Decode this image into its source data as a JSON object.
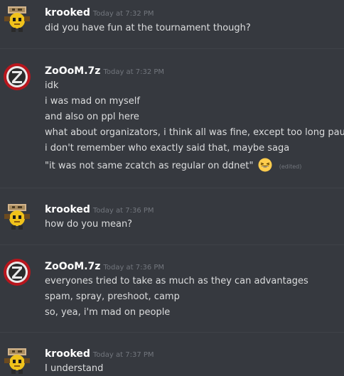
{
  "messages": [
    {
      "username": "krooked",
      "timestamp": "Today at 7:32 PM",
      "avatar_icon": "pixel-hero-avatar-icon",
      "lines": [
        "did you have fun at the tournament though?"
      ]
    },
    {
      "username": "ZoOoM.7z",
      "timestamp": "Today at 7:32 PM",
      "avatar_icon": "z-logo-avatar-icon",
      "lines": [
        "idk",
        "i was mad on myself",
        "and also on ppl here",
        "what about organizators, i think all was fine, except too long pauses",
        "i don't remember who exactly said that, maybe saga",
        "\"it was not same zcatch as regular on ddnet\""
      ],
      "edited_label": "(edited)",
      "emoji_icon": "grinning-squint-emoji-icon"
    },
    {
      "username": "krooked",
      "timestamp": "Today at 7:36 PM",
      "avatar_icon": "pixel-hero-avatar-icon",
      "lines": [
        "how do you mean?"
      ]
    },
    {
      "username": "ZoOoM.7z",
      "timestamp": "Today at 7:36 PM",
      "avatar_icon": "z-logo-avatar-icon",
      "lines": [
        "everyones tried to take as much as they can advantages",
        "spam, spray, preshoot, camp",
        "so, yea, i'm mad on people"
      ]
    },
    {
      "username": "krooked",
      "timestamp": "Today at 7:37 PM",
      "avatar_icon": "pixel-hero-avatar-icon",
      "lines": [
        "I understand"
      ]
    }
  ],
  "colors": {
    "background": "#36393f",
    "username": "#ffffff",
    "timestamp": "#72767d",
    "message_text": "#dcddde",
    "divider": "#3f4248"
  }
}
